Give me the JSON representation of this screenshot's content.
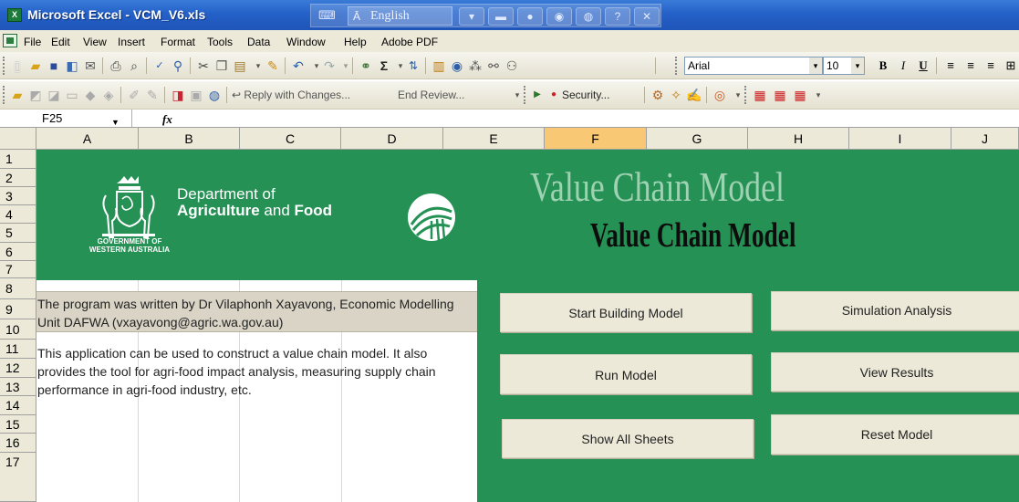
{
  "window": {
    "title": "Microsoft Excel - VCM_V6.xls",
    "app_icon": "excel-icon"
  },
  "language_bar": {
    "language": "English"
  },
  "menu": [
    "File",
    "Edit",
    "View",
    "Insert",
    "Format",
    "Tools",
    "Data",
    "Window",
    "Help",
    "Adobe PDF"
  ],
  "toolbar_standard": {
    "font": "Arial",
    "font_size": "10"
  },
  "toolbar_review": {
    "reply_label": "Reply with Changes...",
    "end_review_label": "End Review...",
    "security_label": "Security..."
  },
  "formula_bar": {
    "cell_ref": "F25",
    "fx": "fx"
  },
  "columns": [
    "A",
    "B",
    "C",
    "D",
    "E",
    "F",
    "G",
    "H",
    "I",
    "J"
  ],
  "active_column": "F",
  "rows": [
    "1",
    "2",
    "3",
    "4",
    "5",
    "6",
    "7",
    "8",
    "9",
    "10",
    "11",
    "12",
    "13",
    "14",
    "15",
    "16",
    "17"
  ],
  "logo": {
    "line1": "Department of",
    "line2_bold": "Agriculture",
    "line2_mid": " and ",
    "line2_end": "Food",
    "crest_caption_1": "GOVERNMENT OF",
    "crest_caption_2": "WESTERN AUSTRALIA"
  },
  "credit": "The program was written by Dr Vilaphonh Xayavong, Economic Modelling Unit DAFWA (vxayavong@agric.wa.gov.au)",
  "description": "This application can be used to construct a value chain model. It also provides the tool for agri-food impact analysis, measuring supply chain performance in agri-food industry, etc.",
  "panel": {
    "title_shadow": "Value Chain Model",
    "title": "Value Chain Model",
    "buttons": {
      "start": "Start Building Model",
      "simulation": "Simulation Analysis",
      "run": "Run Model",
      "view": "View Results",
      "show": "Show All Sheets",
      "reset": "Reset Model"
    }
  },
  "colors": {
    "panel_green": "#259155",
    "title_blue": "#2461c8",
    "active_header": "#f8c874"
  }
}
